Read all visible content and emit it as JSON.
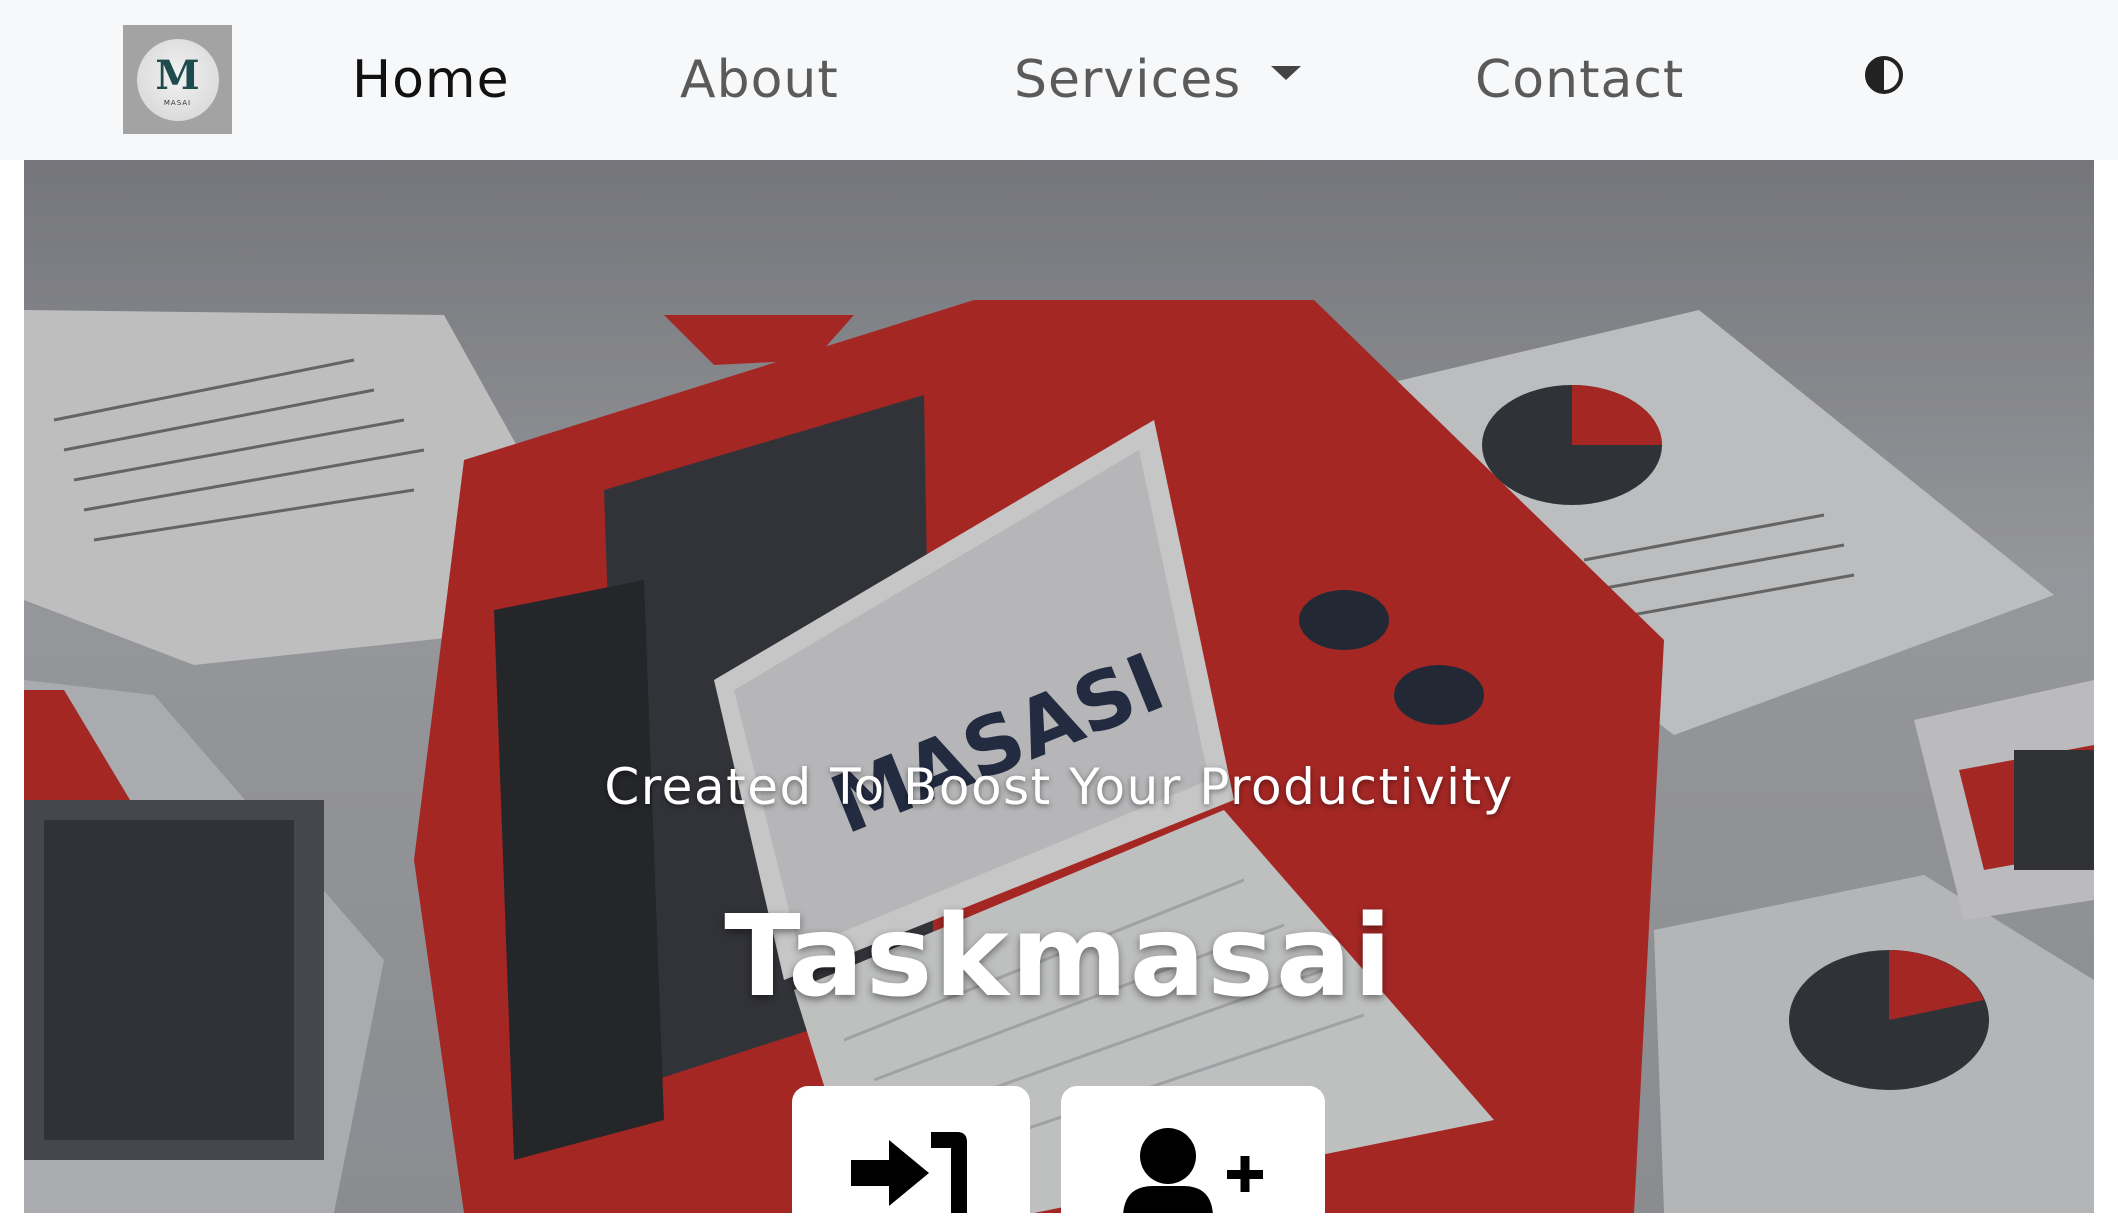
{
  "nav": {
    "logo_text": "MASAI",
    "items": [
      {
        "label": "Home",
        "active": true
      },
      {
        "label": "About",
        "active": false
      },
      {
        "label": "Services",
        "active": false,
        "has_dropdown": true
      },
      {
        "label": "Contact",
        "active": false
      }
    ],
    "theme_toggle_icon": "contrast-icon"
  },
  "hero": {
    "subtitle": "Created To Boost Your Productivity",
    "title": "Taskmasai",
    "screen_logo": "MASASI",
    "buttons": [
      {
        "icon": "sign-in-icon"
      },
      {
        "icon": "user-plus-icon"
      }
    ]
  },
  "colors": {
    "nav_bg": "#f7f8fa",
    "accent_red": "#c9302c",
    "dark_gray": "#3a3d44"
  }
}
